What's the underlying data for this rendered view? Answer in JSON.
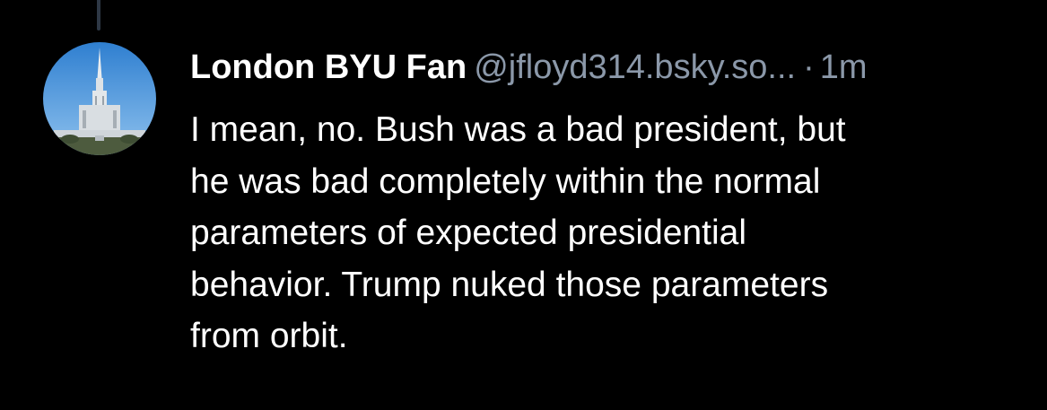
{
  "post": {
    "author": {
      "display_name": "London BYU Fan",
      "handle": "@jfloyd314.bsky.so...",
      "avatar_icon": "temple-spire-avatar"
    },
    "separator": "·",
    "timestamp": "1m",
    "text_lines": [
      "I mean, no. Bush was a bad president, but",
      "he was bad completely within the normal",
      "parameters of expected presidential",
      "behavior. Trump nuked those parameters",
      "from orbit."
    ]
  },
  "colors": {
    "background": "#000000",
    "text_primary": "#ffffff",
    "text_secondary": "#8b98a9",
    "thread_line": "#2e3845"
  }
}
